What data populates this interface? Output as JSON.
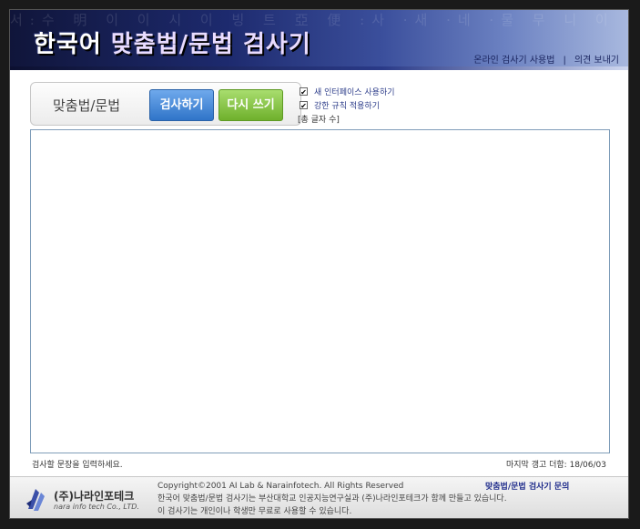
{
  "header": {
    "title_part1": "한국어",
    "title_part2": "맞춤법/문법 검사기",
    "bg_text": "서:수 明 이 이 시 이 빙 트 亞 便 :사 ·새 ·네 ·물 무 니 이 文 나",
    "links": {
      "usage": "온라인 검사기 사용법",
      "separator": "|",
      "feedback": "의견 보내기"
    }
  },
  "controls": {
    "label": "맞춤법/문법",
    "check_button": "검사하기",
    "reset_button": "다시 쓰기",
    "options": [
      {
        "label": "새 인터페이스 사용하기",
        "checked": true,
        "mark": "✔"
      },
      {
        "label": "강한 규칙 적용하기",
        "checked": true,
        "mark": "✔"
      }
    ],
    "char_count": "[총 글자 수]"
  },
  "editor": {
    "value": ""
  },
  "status": {
    "hint": "검사할 문장을 입력하세요.",
    "last_update": "마지막 갱고 더함: 18/06/03"
  },
  "footer": {
    "logo_name": "(주)나라인포테크",
    "logo_sub": "nara info tech Co., LTD.",
    "copyright": "Copyright©2001 AI Lab & Narainfotech. All Rights Reserved",
    "line2": "한국어 맞춤법/문법 검사기는 부산대학교 인공지능연구실과 (주)나라인포테크가 함께 만들고 있습니다.",
    "line3": "이 검사기는 개인이나 학생만 무료로 사용할 수 있습니다.",
    "inquiry": "맞춤법/문법 검사기 문의"
  },
  "colors": {
    "accent_blue": "#2f74c8",
    "accent_green": "#6fb02c",
    "header_dark": "#10153a"
  }
}
